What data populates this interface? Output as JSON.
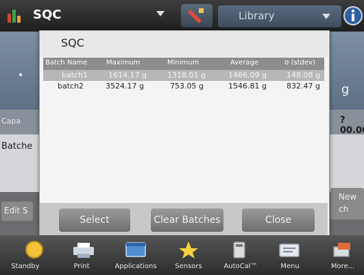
{
  "header": {
    "app_title": "SQC",
    "library_label": "Library"
  },
  "background": {
    "unit": "g",
    "capacity_label": "Capa",
    "capacity_value": "?00.00",
    "batches_label": "Batche",
    "edit_label": "Edit S",
    "new_label": "New\nch"
  },
  "dialog": {
    "title": "SQC",
    "columns": [
      "Batch Name",
      "Maximum",
      "Minimum",
      "Average",
      "σ (stdev)"
    ],
    "rows": [
      [
        "batch1",
        "1614.17 g",
        "1318.01 g",
        "1466.09 g",
        "148.08 g"
      ],
      [
        "batch2",
        "3524.17 g",
        "753.05 g",
        "1546.81 g",
        "832.47 g"
      ]
    ],
    "selected_row": 0,
    "buttons": {
      "select": "Select",
      "clear": "Clear Batches",
      "close": "Close"
    }
  },
  "taskbar": {
    "items": [
      {
        "label": "Standby",
        "icon": "standby-icon"
      },
      {
        "label": "Print",
        "icon": "print-icon"
      },
      {
        "label": "Applications",
        "icon": "applications-icon"
      },
      {
        "label": "Sensors",
        "icon": "sensors-icon"
      },
      {
        "label": "AutoCal™",
        "icon": "autocal-icon"
      },
      {
        "label": "Menu",
        "icon": "menu-icon"
      },
      {
        "label": "More...",
        "icon": "more-icon"
      }
    ]
  },
  "colors": {
    "accent_blue": "#3f6fb0",
    "button_gray": "#7c7c7c",
    "dialog_bg": "#f4f4f4"
  }
}
